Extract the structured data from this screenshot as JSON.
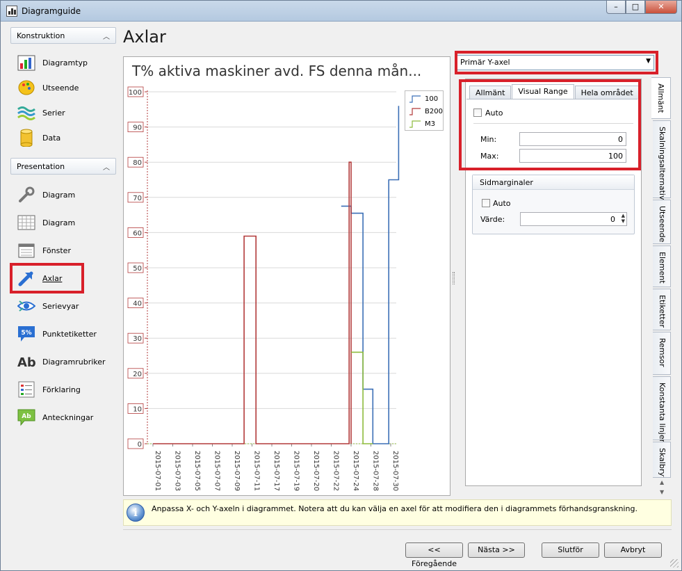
{
  "window": {
    "title": "Diagramguide"
  },
  "page": {
    "title": "Axlar"
  },
  "nav": {
    "groups": [
      {
        "label": "Konstruktion",
        "items": [
          {
            "label": "Diagramtyp",
            "icon": "bar-chart-icon"
          },
          {
            "label": "Utseende",
            "icon": "palette-icon"
          },
          {
            "label": "Serier",
            "icon": "series-icon"
          },
          {
            "label": "Data",
            "icon": "database-icon"
          }
        ]
      },
      {
        "label": "Presentation",
        "items": [
          {
            "label": "Diagram",
            "icon": "wrench-icon"
          },
          {
            "label": "Diagram",
            "icon": "grid-icon"
          },
          {
            "label": "Fönster",
            "icon": "window-icon"
          },
          {
            "label": "Axlar",
            "icon": "axis-arrow-icon",
            "active": true
          },
          {
            "label": "Serievyar",
            "icon": "eye-icon"
          },
          {
            "label": "Punktetiketter",
            "icon": "percent-label-icon"
          },
          {
            "label": "Diagramrubriker",
            "icon": "text-ab-icon"
          },
          {
            "label": "Förklaring",
            "icon": "legend-icon"
          },
          {
            "label": "Anteckningar",
            "icon": "note-icon"
          }
        ]
      }
    ]
  },
  "chart_data": {
    "type": "line",
    "title": "T% aktiva maskiner avd. FS denna mån...",
    "x": [
      "2015-07-01",
      "2015-07-03",
      "2015-07-05",
      "2015-07-07",
      "2015-07-09",
      "2015-07-11",
      "2015-07-17",
      "2015-07-19",
      "2015-07-20",
      "2015-07-22",
      "2015-07-24",
      "2015-07-28",
      "2015-07-30"
    ],
    "yticks": [
      0,
      10,
      20,
      30,
      40,
      50,
      60,
      70,
      80,
      90,
      100
    ],
    "ylim": [
      0,
      100
    ],
    "step": true,
    "series": [
      {
        "name": "100",
        "color": "#3b6fb6",
        "points": [
          [
            9.5,
            67.5
          ],
          [
            10,
            67.5
          ],
          [
            10,
            65.5
          ],
          [
            10.6,
            65.5
          ],
          [
            10.6,
            15.5
          ],
          [
            11.1,
            15.5
          ],
          [
            11.1,
            0
          ],
          [
            11.9,
            0
          ],
          [
            11.9,
            75
          ],
          [
            12.4,
            75
          ],
          [
            12.4,
            96
          ]
        ]
      },
      {
        "name": "B200",
        "color": "#b23a3a",
        "points": [
          [
            0,
            0
          ],
          [
            4.6,
            0
          ],
          [
            4.6,
            59
          ],
          [
            5.2,
            59
          ],
          [
            5.2,
            0
          ],
          [
            9.9,
            0
          ],
          [
            9.9,
            80
          ],
          [
            10,
            80
          ],
          [
            10,
            0
          ]
        ]
      },
      {
        "name": "M3",
        "color": "#8dbb3c",
        "points": [
          [
            10,
            26
          ],
          [
            10.6,
            26
          ],
          [
            10.6,
            0
          ],
          [
            11.1,
            0
          ]
        ]
      }
    ],
    "legend": "top-right",
    "grid": true
  },
  "axis_selector": {
    "value": "Primär Y-axel"
  },
  "tabs": [
    "Allmänt",
    "Visual Range",
    "Hela området"
  ],
  "active_tab": 1,
  "visual_range": {
    "auto_label": "Auto",
    "min_label": "Min:",
    "min_value": "0",
    "max_label": "Max:",
    "max_value": "100"
  },
  "side_margins": {
    "title": "Sidmarginaler",
    "auto_label": "Auto",
    "value_label": "Värde:",
    "value": "0"
  },
  "vertical_tabs": [
    "Allmänt",
    "Skalningsalternativ",
    "Utseende",
    "Element",
    "Etiketter",
    "Remsor",
    "Konstanta linjer",
    "Skalbryt"
  ],
  "info": {
    "text": "Anpassa X- och Y-axeln i diagrammet. Notera att du kan välja en axel för att modifiera den i diagrammets förhandsgranskning."
  },
  "buttons": {
    "prev": "<< Föregående",
    "next": "Nästa >>",
    "finish": "Slutför",
    "cancel": "Avbryt"
  },
  "colors": {
    "highlight": "#d8202a",
    "accent": "#3b6fb6"
  }
}
